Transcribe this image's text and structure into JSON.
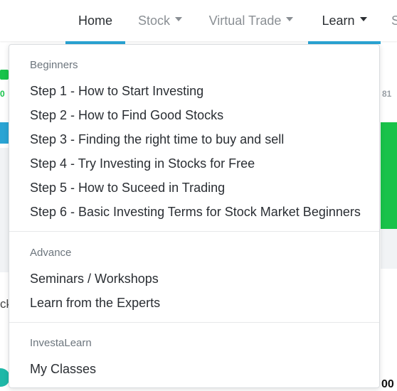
{
  "colors": {
    "accent": "#2aa4d4",
    "green": "#17c34a",
    "dark_green": "#1f8a3a"
  },
  "nav": {
    "home": "Home",
    "stock": "Stock",
    "virtual_trade": "Virtual Trade",
    "learn": "Learn",
    "partial": "S"
  },
  "background": {
    "left_ticker_value": "0",
    "right_ticker_value": "81",
    "left_cut_text": "ck",
    "bottom_right_value": "00"
  },
  "dropdown": {
    "sections": [
      {
        "header": "Beginners",
        "items": [
          "Step 1 - How to Start Investing",
          "Step 2 - How to Find Good Stocks",
          "Step 3 - Finding the right time to buy and sell",
          "Step 4 - Try Investing in Stocks for Free",
          "Step 5 - How to Suceed in Trading",
          "Step 6 - Basic Investing Terms for Stock Market Beginners"
        ]
      },
      {
        "header": "Advance",
        "items": [
          "Seminars / Workshops",
          "Learn from the Experts"
        ]
      },
      {
        "header": "InvestaLearn",
        "items": [
          "My Classes"
        ]
      }
    ]
  }
}
